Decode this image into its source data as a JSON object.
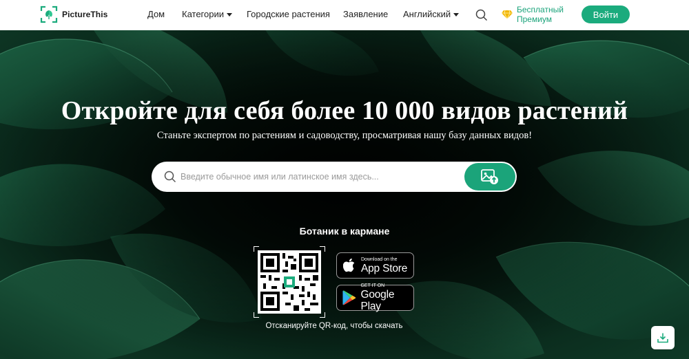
{
  "header": {
    "logo_text": "PictureThis",
    "nav": {
      "home": "Дом",
      "categories": "Категории",
      "city_plants": "Городские растения",
      "statement": "Заявление",
      "language": "Английский"
    },
    "premium_line1": "Бесплатный",
    "premium_line2": "Премиум",
    "login": "Войти"
  },
  "hero": {
    "title": "Откройте для себя более 10 000 видов растений",
    "subtitle": "Станьте экспертом по растениям и садоводству, просматривая нашу базу данных видов!",
    "search_placeholder": "Введите обычное имя или латинское имя здесь..."
  },
  "app": {
    "title": "Ботаник в кармане",
    "app_store_small": "Download on the",
    "app_store_big": "App Store",
    "google_small": "GET IT ON",
    "google_big": "Google Play",
    "qr_caption": "Отсканируйте QR-код, чтобы скачать"
  },
  "colors": {
    "brand_green": "#1bab7d",
    "premium_gold": "#f2b705"
  },
  "icons": [
    "logo-icon",
    "search-icon",
    "diamond-icon",
    "image-upload-icon",
    "apple-icon",
    "google-play-icon",
    "qr-code",
    "download-icon"
  ]
}
